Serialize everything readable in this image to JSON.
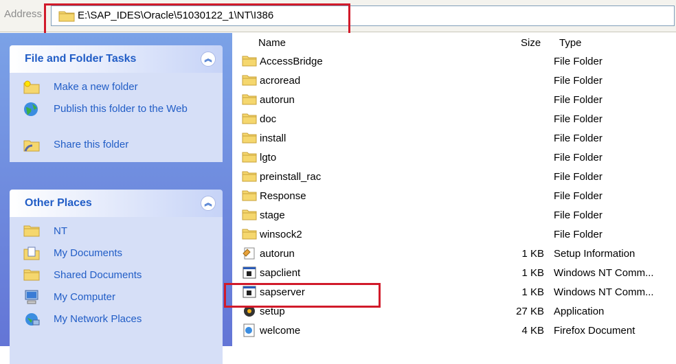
{
  "address_bar": {
    "label": "Address",
    "path": "E:\\SAP_IDES\\Oracle\\51030122_1\\NT\\I386"
  },
  "task_pane": {
    "file_folder_tasks": {
      "title": "File and Folder Tasks",
      "items": [
        {
          "label": "Make a new folder",
          "icon": "new-folder-icon"
        },
        {
          "label": "Publish this folder to the Web",
          "icon": "globe-icon"
        },
        {
          "label": "Share this folder",
          "icon": "share-folder-icon"
        }
      ]
    },
    "other_places": {
      "title": "Other Places",
      "items": [
        {
          "label": "NT",
          "icon": "folder-icon"
        },
        {
          "label": "My Documents",
          "icon": "documents-icon"
        },
        {
          "label": "Shared Documents",
          "icon": "folder-icon"
        },
        {
          "label": "My Computer",
          "icon": "computer-icon"
        },
        {
          "label": "My Network Places",
          "icon": "network-icon"
        }
      ]
    }
  },
  "file_list": {
    "columns": {
      "name": "Name",
      "size": "Size",
      "type": "Type"
    },
    "rows": [
      {
        "name": "AccessBridge",
        "size": "",
        "type": "File Folder",
        "icon": "folder-icon"
      },
      {
        "name": "acroread",
        "size": "",
        "type": "File Folder",
        "icon": "folder-icon"
      },
      {
        "name": "autorun",
        "size": "",
        "type": "File Folder",
        "icon": "folder-icon"
      },
      {
        "name": "doc",
        "size": "",
        "type": "File Folder",
        "icon": "folder-icon"
      },
      {
        "name": "install",
        "size": "",
        "type": "File Folder",
        "icon": "folder-icon"
      },
      {
        "name": "lgto",
        "size": "",
        "type": "File Folder",
        "icon": "folder-icon"
      },
      {
        "name": "preinstall_rac",
        "size": "",
        "type": "File Folder",
        "icon": "folder-icon"
      },
      {
        "name": "Response",
        "size": "",
        "type": "File Folder",
        "icon": "folder-icon"
      },
      {
        "name": "stage",
        "size": "",
        "type": "File Folder",
        "icon": "folder-icon"
      },
      {
        "name": "winsock2",
        "size": "",
        "type": "File Folder",
        "icon": "folder-icon"
      },
      {
        "name": "autorun",
        "size": "1 KB",
        "type": "Setup Information",
        "icon": "setup-info-icon"
      },
      {
        "name": "sapclient",
        "size": "1 KB",
        "type": "Windows NT Comm...",
        "icon": "cmd-script-icon"
      },
      {
        "name": "sapserver",
        "size": "1 KB",
        "type": "Windows NT Comm...",
        "icon": "cmd-script-icon"
      },
      {
        "name": "setup",
        "size": "27 KB",
        "type": "Application",
        "icon": "application-icon"
      },
      {
        "name": "welcome",
        "size": "4 KB",
        "type": "Firefox Document",
        "icon": "html-document-icon"
      }
    ]
  },
  "colors": {
    "highlight": "#d11a2a",
    "task_text": "#215dc6",
    "task_pane_bg": "#7ba2e7"
  }
}
